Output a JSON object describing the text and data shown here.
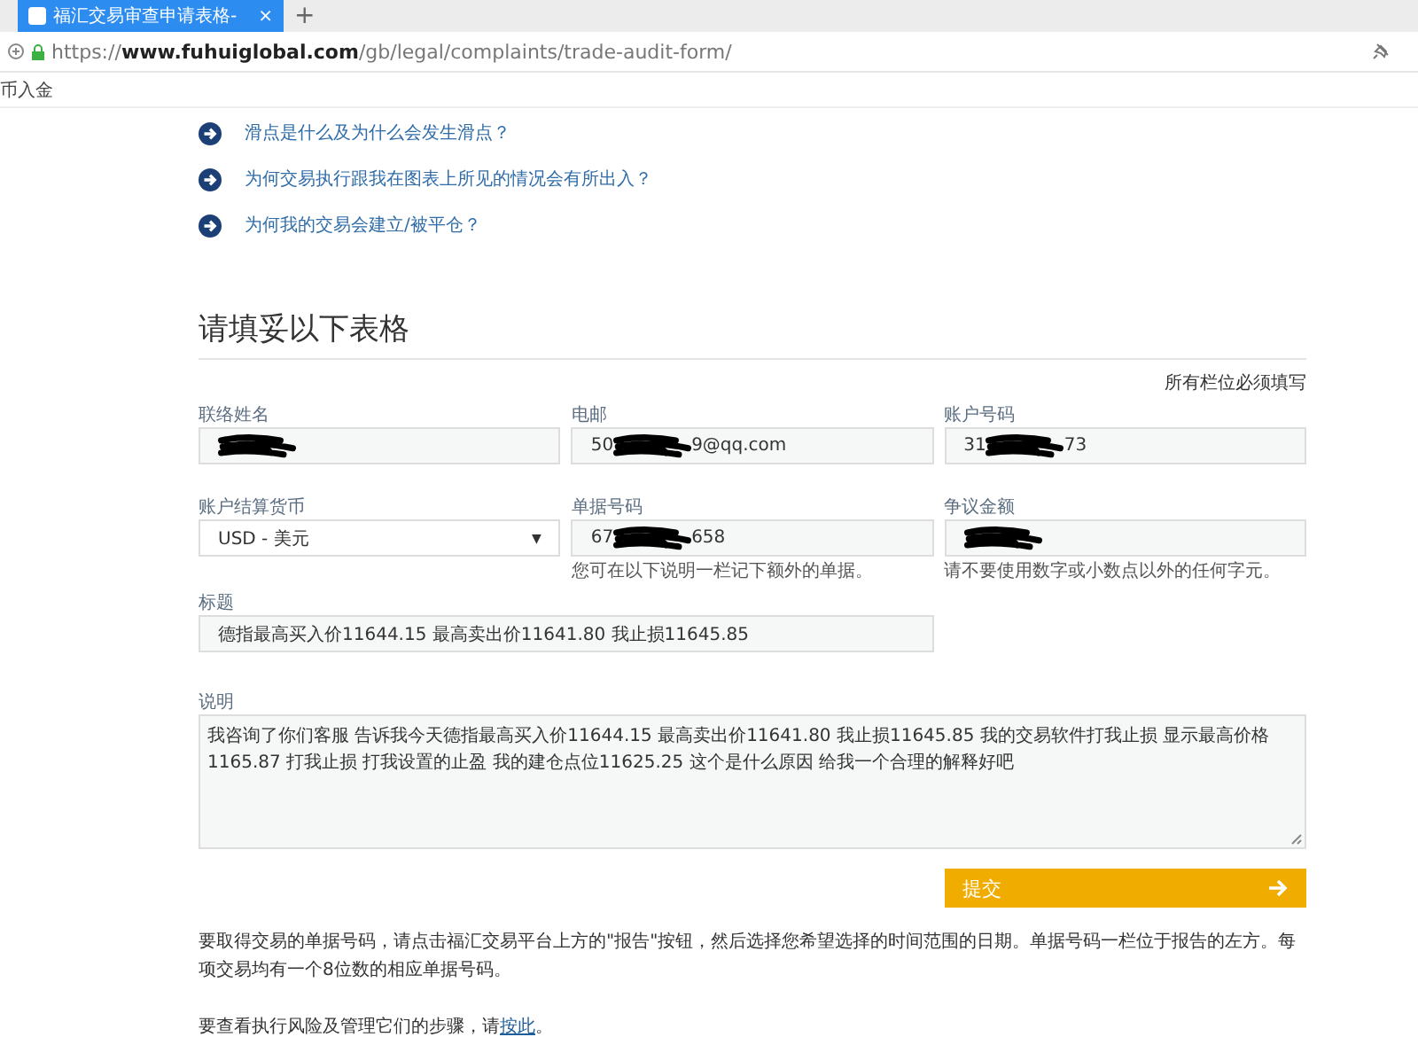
{
  "browser": {
    "tabs": [
      {
        "title": "福汇交易审查申请表格-",
        "selected": true,
        "close": "×"
      }
    ],
    "new_tab": "+",
    "url": {
      "scheme": "https://",
      "host": "www.fuhuiglobal.com",
      "path": "/gb/legal/complaints/trade-audit-form/"
    },
    "bookmarks": [
      "币入金"
    ]
  },
  "links": [
    {
      "text": "滑点是什么及为什么会发生滑点？"
    },
    {
      "text": "为何交易执行跟我在图表上所见的情况会有所出入？"
    },
    {
      "text": "为何我的交易会建立/被平仓？"
    }
  ],
  "form": {
    "heading": "请填妥以下表格",
    "required_note": "所有栏位必须填写",
    "rows": [
      [
        {
          "kind": "input",
          "label": "联络姓名",
          "redacted": true
        },
        {
          "kind": "input",
          "label": "电邮",
          "value_start": "50",
          "value_end": "9@qq.com",
          "redacted": true
        },
        {
          "kind": "input",
          "label": "账户号码",
          "value_start": "31",
          "value_end": "73",
          "redacted": true
        }
      ],
      [
        {
          "kind": "select",
          "label": "账户结算货币",
          "value_start": "USD - 美元",
          "caret": "▼"
        },
        {
          "kind": "input",
          "label": "单据号码",
          "value_start": "67",
          "value_end": "658",
          "redacted": true,
          "hint": "您可在以下说明一栏记下额外的单据。"
        },
        {
          "kind": "input",
          "label": "争议金额",
          "redacted": true,
          "hint": "请不要使用数字或小数点以外的任何字元。"
        }
      ]
    ],
    "title_field": {
      "label": "标题",
      "value": "德指最高买入价11644.15 最高卖出价11641.80 我止损11645.85"
    },
    "description": {
      "label": "说明",
      "value": "我咨询了你们客服 告诉我今天德指最高买入价11644.15 最高卖出价11641.80 我止损11645.85  我的交易软件打我止损 显示最高价格1165.87  打我止损 打我设置的止盈 我的建仓点位11625.25  这个是什么原因  给我一个合理的解释好吧"
    },
    "submit": "提交"
  },
  "notes": [
    {
      "text": "要取得交易的单据号码，请点击福汇交易平台上方的\"报告\"按钮，然后选择您希望选择的时间范围的日期。单据号码一栏位于报告的左方。每项交易均有一个8位数的相应单据号码。"
    },
    {
      "text": "要查看执行风险及管理它们的步骤，请",
      "link": "按此",
      "after": "。"
    }
  ]
}
